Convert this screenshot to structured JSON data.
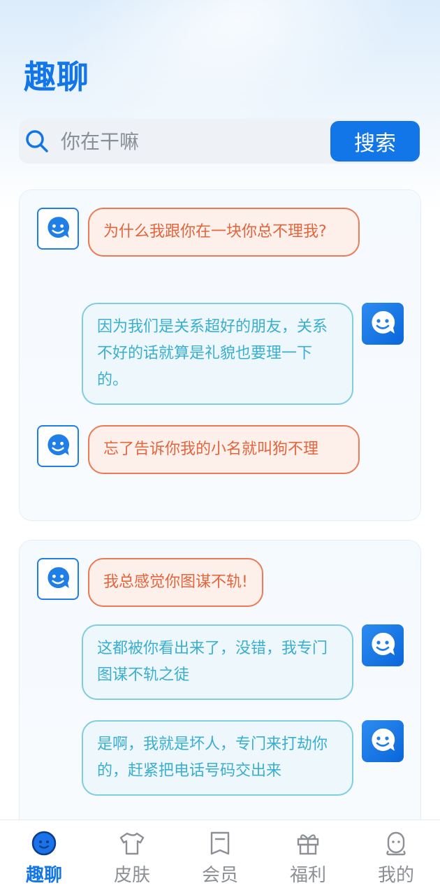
{
  "app": {
    "title": "趣聊"
  },
  "search": {
    "placeholder": "你在干嘛",
    "button_label": "搜索"
  },
  "cards": [
    {
      "messages": [
        {
          "role": "user",
          "text": "为什么我跟你在一块你总不理我?"
        },
        {
          "role": "bot",
          "text": "因为我们是关系超好的朋友，关系不好的话就算是礼貌也要理一下的。"
        },
        {
          "role": "user",
          "text": "忘了告诉你我的小名就叫狗不理"
        }
      ]
    },
    {
      "messages": [
        {
          "role": "user",
          "text": "我总感觉你图谋不轨!"
        },
        {
          "role": "bot",
          "text": "这都被你看出来了，没错，我专门图谋不轨之徒"
        },
        {
          "role": "bot",
          "text": "是啊，我就是坏人，专门来打劫你的，赶紧把电话号码交出来"
        }
      ]
    }
  ],
  "tabs": [
    {
      "label": "趣聊",
      "icon": "smile-face-icon",
      "active": true
    },
    {
      "label": "皮肤",
      "icon": "tshirt-icon",
      "active": false
    },
    {
      "label": "会员",
      "icon": "member-card-icon",
      "active": false
    },
    {
      "label": "福利",
      "icon": "gift-icon",
      "active": false
    },
    {
      "label": "我的",
      "icon": "user-icon",
      "active": false
    }
  ],
  "colors": {
    "accent": "#1276e8",
    "user_bubble_border": "#eb7a55",
    "user_bubble_text": "#e4643c",
    "bot_bubble_border": "#7fcde0",
    "bot_bubble_text": "#3aaed0",
    "tab_inactive": "#8c8f94"
  }
}
